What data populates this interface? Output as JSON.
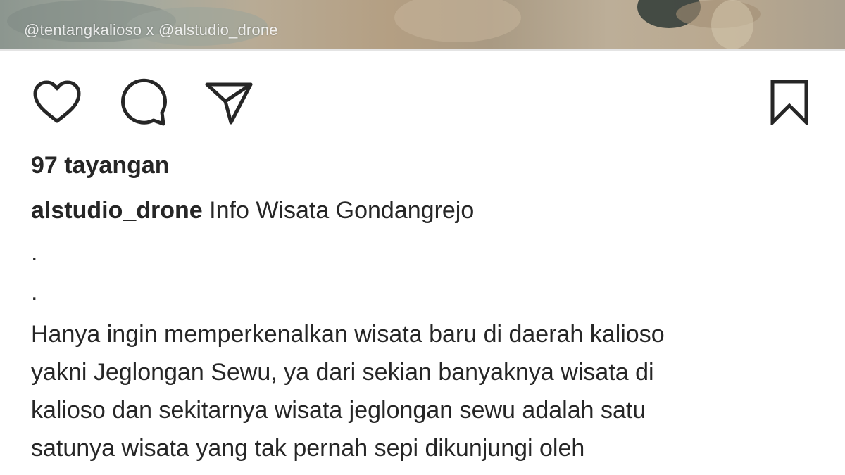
{
  "media": {
    "watermark": "@tentangkalioso x @alstudio_drone"
  },
  "actions": {
    "like_icon": "heart-icon",
    "comment_icon": "comment-bubble-icon",
    "share_icon": "paper-plane-icon",
    "save_icon": "bookmark-icon"
  },
  "post": {
    "views": "97 tayangan",
    "username": "alstudio_drone",
    "caption_first": "Info Wisata Gondangrejo",
    "dot1": ".",
    "dot2": ".",
    "caption_lines": [
      "Hanya ingin memperkenalkan wisata baru di daerah kalioso",
      "yakni Jeglongan Sewu, ya dari sekian banyaknya wisata di",
      "kalioso dan sekitarnya wisata jeglongan sewu adalah satu",
      "satunya wisata yang tak pernah sepi dikunjungi oleh"
    ]
  },
  "colors": {
    "text": "#262626",
    "background": "#ffffff",
    "icon": "#262626"
  }
}
